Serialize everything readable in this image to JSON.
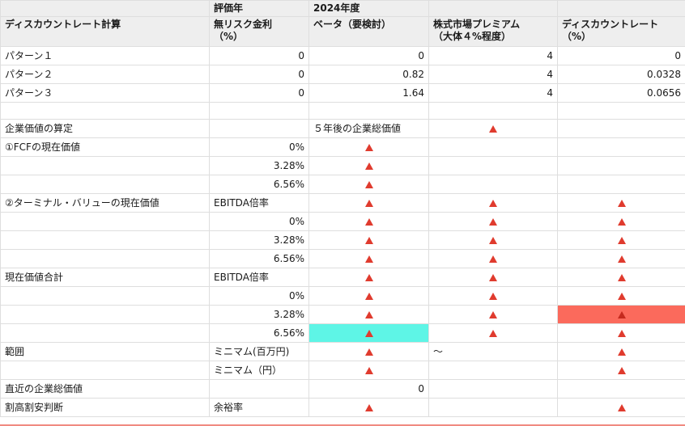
{
  "header": {
    "year_label": "評価年",
    "year_value": "2024年度",
    "title": "ディスカウントレート計算",
    "col_riskfree": "無リスク金利\n（%）",
    "col_beta": "ベータ（要検討）",
    "col_premium": "株式市場プレミアム\n（大体４%程度）",
    "col_discount": "ディスカウントレート\n（%）"
  },
  "patterns": [
    {
      "label": "パターン１",
      "riskfree": "0",
      "beta": "0",
      "premium": "4",
      "discount": "0"
    },
    {
      "label": "パターン２",
      "riskfree": "0",
      "beta": "0.82",
      "premium": "4",
      "discount": "0.0328"
    },
    {
      "label": "パターン３",
      "riskfree": "0",
      "beta": "1.64",
      "premium": "4",
      "discount": "0.0656"
    }
  ],
  "valuation": {
    "title": "企業価値の算定",
    "five_year_label": "５年後の企業総価値",
    "fcf_label": "①FCFの現在価値",
    "terminal_label": "②ターミナル・バリューの現在価値",
    "ebitda_label": "EBITDA倍率",
    "total_label": "現在価値合計",
    "rates": [
      "0%",
      "3.28%",
      "6.56%"
    ],
    "range_label": "範囲",
    "min_million": "ミニマム(百万円)",
    "tilde": "～",
    "min_yen": "ミニマム（円）",
    "recent_label": "直近の企業総価値",
    "recent_value": "0",
    "judge_label": "割高割安判断",
    "margin_label": "余裕率"
  },
  "colors": {
    "cyan_highlight": "#5ef5e6",
    "red_highlight": "#fb6a5c",
    "warning": "#e03b2e"
  },
  "icons": {
    "error": "warning-triangle-icon"
  }
}
